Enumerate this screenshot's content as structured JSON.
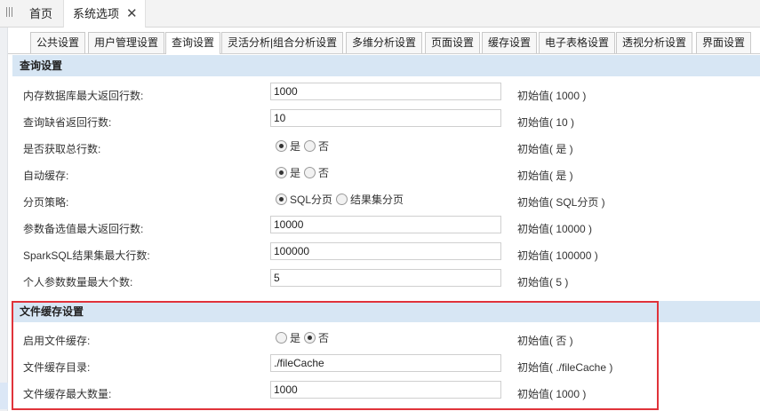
{
  "top_tabs": [
    {
      "label": "首页"
    },
    {
      "label": "系统选项",
      "close": "✕"
    }
  ],
  "sub_tabs": [
    "公共设置",
    "用户管理设置",
    "查询设置",
    "灵活分析|组合分析设置",
    "多维分析设置",
    "页面设置",
    "缓存设置",
    "电子表格设置",
    "透视分析设置",
    "界面设置"
  ],
  "active_sub_tab": "查询设置",
  "sections": [
    {
      "title": "查询设置",
      "rows": [
        {
          "label": "内存数据库最大返回行数:",
          "type": "text",
          "value": "1000",
          "initial": "初始值( 1000 )"
        },
        {
          "label": "查询缺省返回行数:",
          "type": "text",
          "value": "10",
          "initial": "初始值( 10 )"
        },
        {
          "label": "是否获取总行数:",
          "type": "radio",
          "options": [
            "是",
            "否"
          ],
          "selected": 0,
          "initial": "初始值( 是 )"
        },
        {
          "label": "自动缓存:",
          "type": "radio",
          "options": [
            "是",
            "否"
          ],
          "selected": 0,
          "initial": "初始值( 是 )"
        },
        {
          "label": "分页策略:",
          "type": "radio",
          "options": [
            "SQL分页",
            "结果集分页"
          ],
          "selected": 0,
          "initial": "初始值( SQL分页 )"
        },
        {
          "label": "参数备选值最大返回行数:",
          "type": "text",
          "value": "10000",
          "initial": "初始值( 10000 )"
        },
        {
          "label": "SparkSQL结果集最大行数:",
          "type": "text",
          "value": "100000",
          "initial": "初始值( 100000 )"
        },
        {
          "label": "个人参数数量最大个数:",
          "type": "text",
          "value": "5",
          "initial": "初始值( 5 )"
        }
      ]
    },
    {
      "title": "文件缓存设置",
      "rows": [
        {
          "label": "启用文件缓存:",
          "type": "radio",
          "options": [
            "是",
            "否"
          ],
          "selected": 1,
          "initial": "初始值( 否 )"
        },
        {
          "label": "文件缓存目录:",
          "type": "text",
          "value": "./fileCache",
          "initial": "初始值( ./fileCache )"
        },
        {
          "label": "文件缓存最大数量:",
          "type": "text",
          "value": "1000",
          "initial": "初始值( 1000 )"
        }
      ]
    }
  ],
  "colors": {
    "section_header": "#d7e6f4",
    "highlight_border": "#e0333a"
  }
}
